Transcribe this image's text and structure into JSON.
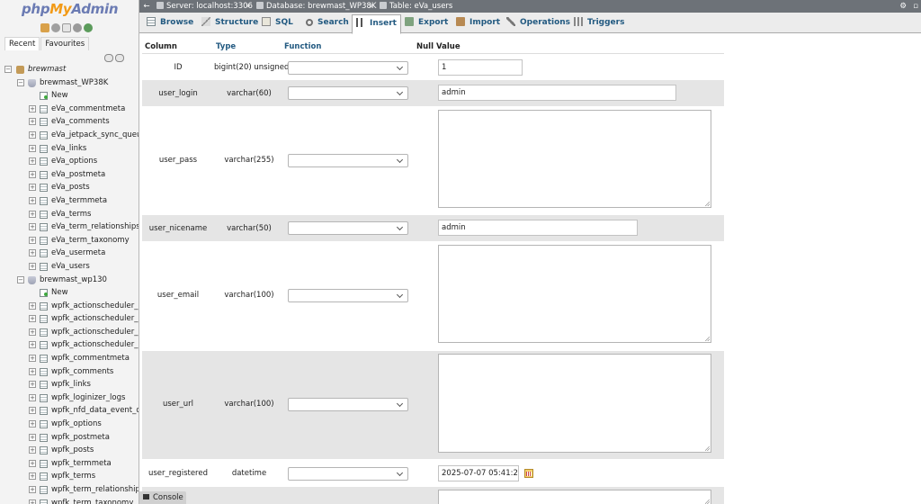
{
  "logo": {
    "php": "php",
    "my": "My",
    "admin": "Admin"
  },
  "nav_tabs": [
    "Recent",
    "Favourites"
  ],
  "breadcrumb": {
    "server": "Server: localhost:3306",
    "database": "Database: brewmast_WP38K",
    "table": "Table: eVa_users",
    "separator": "»"
  },
  "tabs": [
    "Browse",
    "Structure",
    "SQL",
    "Search",
    "Insert",
    "Export",
    "Import",
    "Operations",
    "Triggers"
  ],
  "active_tab": "Insert",
  "tree": {
    "server_db": "brewmast",
    "db1": "brewmast_WP38K",
    "db1_new": "New",
    "db1_tables": [
      "eVa_commentmeta",
      "eVa_comments",
      "eVa_jetpack_sync_queue",
      "eVa_links",
      "eVa_options",
      "eVa_postmeta",
      "eVa_posts",
      "eVa_termmeta",
      "eVa_terms",
      "eVa_term_relationships",
      "eVa_term_taxonomy",
      "eVa_usermeta",
      "eVa_users"
    ],
    "db2": "brewmast_wp130",
    "db2_new": "New",
    "db2_tables": [
      "wpfk_actionscheduler_act",
      "wpfk_actionscheduler_cla",
      "wpfk_actionscheduler_gro",
      "wpfk_actionscheduler_log",
      "wpfk_commentmeta",
      "wpfk_comments",
      "wpfk_links",
      "wpfk_loginizer_logs",
      "wpfk_nfd_data_event_que",
      "wpfk_options",
      "wpfk_postmeta",
      "wpfk_posts",
      "wpfk_termmeta",
      "wpfk_terms",
      "wpfk_term_relationships",
      "wpfk_term_taxonomy"
    ]
  },
  "form": {
    "headers": {
      "column": "Column",
      "type": "Type",
      "function": "Function",
      "null": "Null",
      "value": "Value"
    },
    "rows": [
      {
        "column": "ID",
        "type": "bigint(20) unsigned",
        "value": "1"
      },
      {
        "column": "user_login",
        "type": "varchar(60)",
        "value": "admin"
      },
      {
        "column": "user_pass",
        "type": "varchar(255)",
        "value": ""
      },
      {
        "column": "user_nicename",
        "type": "varchar(50)",
        "value": "admin"
      },
      {
        "column": "user_email",
        "type": "varchar(100)",
        "value": ""
      },
      {
        "column": "user_url",
        "type": "varchar(100)",
        "value": ""
      },
      {
        "column": "user_registered",
        "type": "datetime",
        "value": "2025-07-07 05:41:25"
      }
    ]
  },
  "console": {
    "label": "Console"
  }
}
